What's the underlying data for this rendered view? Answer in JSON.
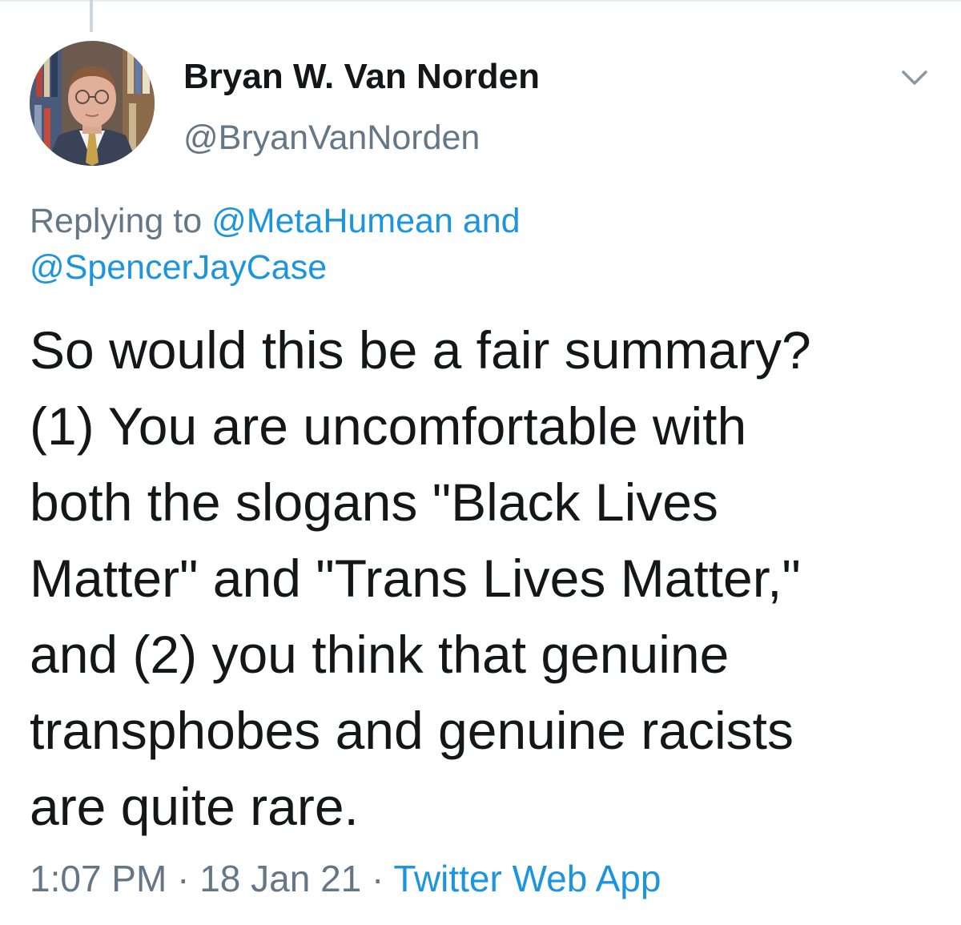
{
  "tweet": {
    "author": {
      "name": "Bryan W. Van Norden",
      "handle": "@BryanVanNorden"
    },
    "reply": {
      "prefix": "Replying to",
      "mentions": [
        "@MetaHumean",
        "@SpencerJayCase"
      ],
      "conjunction": "and"
    },
    "body_lines": [
      "So would this be a fair summary?",
      "(1) You are uncomfortable with",
      "both the slogans \"Black Lives",
      "Matter\" and \"Trans Lives Matter,\"",
      "and (2) you think that genuine",
      "transphobes and genuine racists",
      "are quite rare."
    ],
    "time": "1:07 PM",
    "date": "18 Jan 21",
    "separator": "·",
    "source": "Twitter Web App"
  },
  "icons": {
    "menu": "chevron-down-icon",
    "avatar": "profile-photo"
  },
  "colors": {
    "text": "#14171a",
    "secondary": "#657786",
    "link": "#1b95e0",
    "thread_line": "#ccd6dd"
  }
}
